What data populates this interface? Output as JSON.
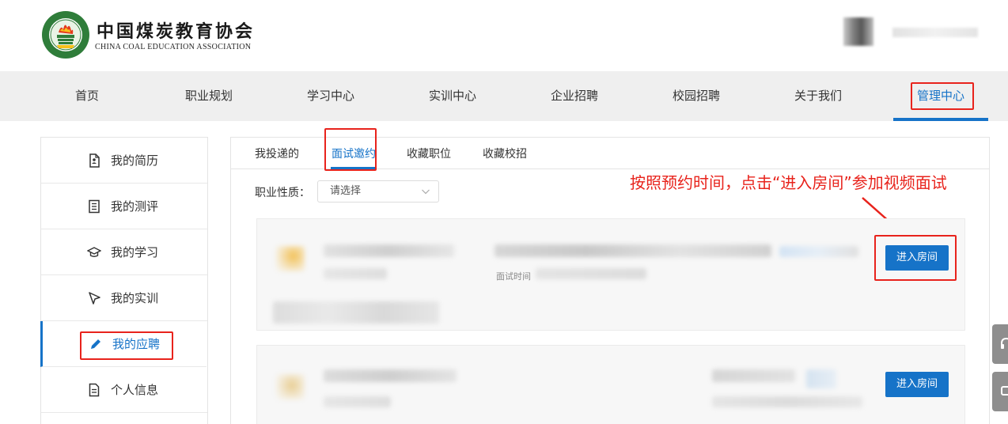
{
  "header": {
    "brand_cn": "中国煤炭教育协会",
    "brand_en": "CHINA COAL EDUCATION ASSOCIATION",
    "logo_icon": "coal-education-association-logo"
  },
  "nav": {
    "items": [
      {
        "label": "首页"
      },
      {
        "label": "职业规划"
      },
      {
        "label": "学习中心"
      },
      {
        "label": "实训中心"
      },
      {
        "label": "企业招聘"
      },
      {
        "label": "校园招聘"
      },
      {
        "label": "关于我们"
      },
      {
        "label": "管理中心",
        "active": true
      }
    ]
  },
  "sidebar": {
    "items": [
      {
        "label": "我的简历",
        "icon": "resume-icon"
      },
      {
        "label": "我的测评",
        "icon": "assessment-icon"
      },
      {
        "label": "我的学习",
        "icon": "graduation-cap-icon"
      },
      {
        "label": "我的实训",
        "icon": "cursor-icon"
      },
      {
        "label": "我的应聘",
        "icon": "pencil-icon",
        "active": true
      },
      {
        "label": "个人信息",
        "icon": "document-icon"
      }
    ]
  },
  "tabs": [
    {
      "label": "我投递的"
    },
    {
      "label": "面试邀约",
      "active": true
    },
    {
      "label": "收藏职位"
    },
    {
      "label": "收藏校招"
    }
  ],
  "filter": {
    "label": "职业性质：",
    "placeholder": "请选择"
  },
  "annotation": "按照预约时间，点击“进入房间”参加视频面试",
  "cards": [
    {
      "interview_time_label": "面试时间",
      "enter_button": "进入房间"
    },
    {
      "enter_button": "进入房间"
    }
  ],
  "colors": {
    "accent": "#1673c8",
    "highlight": "#e8231c",
    "nav_bg": "#efefef"
  }
}
